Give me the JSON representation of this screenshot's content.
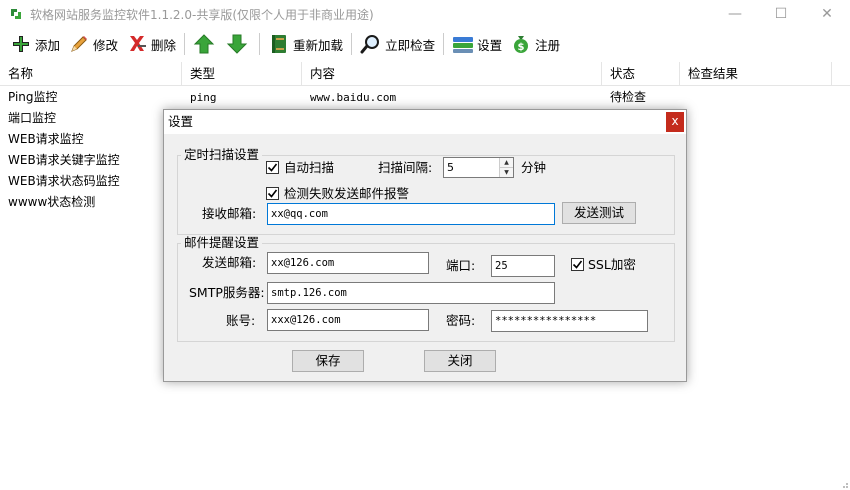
{
  "window": {
    "title": "软格网站服务监控软件1.1.2.0-共享版(仅限个人用于非商业用途)",
    "minimize": "—",
    "maximize": "☐",
    "close": "✕"
  },
  "toolbar": {
    "add": "添加",
    "edit": "修改",
    "delete": "删除",
    "reload": "重新加载",
    "check_now": "立即检查",
    "settings": "设置",
    "register": "注册"
  },
  "grid": {
    "columns": [
      "名称",
      "类型",
      "内容",
      "状态",
      "检查结果"
    ],
    "rows": [
      {
        "name": "Ping监控",
        "type": "ping",
        "content": "www.baidu.com",
        "status": "待检查",
        "result": ""
      },
      {
        "name": "端口监控",
        "type": "",
        "content": "",
        "status": "",
        "result": ""
      },
      {
        "name": "WEB请求监控",
        "type": "",
        "content": "",
        "status": "",
        "result": ""
      },
      {
        "name": "WEB请求关键字监控",
        "type": "",
        "content": "",
        "status": "",
        "result": ""
      },
      {
        "name": "WEB请求状态码监控",
        "type": "",
        "content": "",
        "status": "",
        "result": ""
      },
      {
        "name": "wwww状态检测",
        "type": "",
        "content": "",
        "status": "",
        "result": ""
      }
    ]
  },
  "dialog": {
    "title": "设置",
    "close": "x",
    "scan_group": {
      "label": "定时扫描设置",
      "auto_scan_label": "自动扫描",
      "auto_scan_checked": true,
      "interval_label": "扫描间隔:",
      "interval_value": "5",
      "interval_unit": "分钟",
      "mail_alert_label": "检测失败发送邮件报警",
      "mail_alert_checked": true,
      "recv_label": "接收邮箱:",
      "recv_value": "xx@qq.com",
      "test_button": "发送测试"
    },
    "mail_group": {
      "label": "邮件提醒设置",
      "send_label": "发送邮箱:",
      "send_value": "xx@126.com",
      "port_label": "端口:",
      "port_value": "25",
      "ssl_label": "SSL加密",
      "ssl_checked": true,
      "smtp_label": "SMTP服务器:",
      "smtp_value": "smtp.126.com",
      "account_label": "账号:",
      "account_value": "xxx@126.com",
      "password_label": "密码:",
      "password_value": "****************"
    },
    "save_button": "保存",
    "close_button": "关闭"
  },
  "colors": {
    "close_red": "#c42b1c",
    "focus_blue": "#0078d7",
    "dialog_bg": "#f0f0f0",
    "arrow_green": "#3aa53a"
  }
}
